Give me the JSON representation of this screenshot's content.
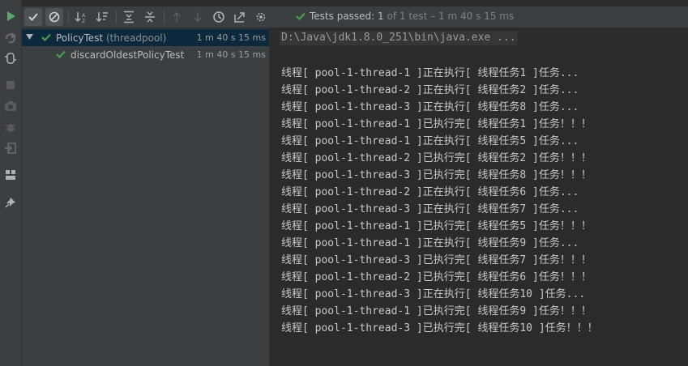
{
  "toolbar": {
    "buttons": [
      "show-passed",
      "show-ignored",
      "sort-alphabetically",
      "sort-by-duration",
      "expand-all",
      "collapse-all",
      "previous-failed",
      "next-failed",
      "test-history",
      "export-results",
      "settings"
    ]
  },
  "status": {
    "label": "Tests passed:",
    "count": "1",
    "of_text": "of 1 test",
    "duration_text": "– 1 m 40 s 15 ms"
  },
  "tree": {
    "root": {
      "name": "PolicyTest",
      "qualifier": "(threadpool)",
      "duration": "1 m 40 s 15 ms"
    },
    "children": [
      {
        "name": "discardOldestPolicyTest",
        "duration": "1 m 40 s 15 ms"
      }
    ]
  },
  "console": {
    "command": "D:\\Java\\jdk1.8.0_251\\bin\\java.exe ...",
    "lines": [
      "线程[ pool-1-thread-1 ]正在执行[ 线程任务1 ]任务...",
      "线程[ pool-1-thread-2 ]正在执行[ 线程任务2 ]任务...",
      "线程[ pool-1-thread-3 ]正在执行[ 线程任务8 ]任务...",
      "线程[ pool-1-thread-1 ]已执行完[ 线程任务1 ]任务！！！",
      "线程[ pool-1-thread-1 ]正在执行[ 线程任务5 ]任务...",
      "线程[ pool-1-thread-2 ]已执行完[ 线程任务2 ]任务！！！",
      "线程[ pool-1-thread-3 ]已执行完[ 线程任务8 ]任务！！！",
      "线程[ pool-1-thread-2 ]正在执行[ 线程任务6 ]任务...",
      "线程[ pool-1-thread-3 ]正在执行[ 线程任务7 ]任务...",
      "线程[ pool-1-thread-1 ]已执行完[ 线程任务5 ]任务！！！",
      "线程[ pool-1-thread-1 ]正在执行[ 线程任务9 ]任务...",
      "线程[ pool-1-thread-3 ]已执行完[ 线程任务7 ]任务！！！",
      "线程[ pool-1-thread-2 ]已执行完[ 线程任务6 ]任务！！！",
      "线程[ pool-1-thread-3 ]正在执行[ 线程任务10 ]任务...",
      "线程[ pool-1-thread-1 ]已执行完[ 线程任务9 ]任务！！！",
      "线程[ pool-1-thread-3 ]已执行完[ 线程任务10 ]任务！！！"
    ]
  },
  "colors": {
    "pass": "#499c54",
    "run": "#59a869",
    "background": "#2b2b2b",
    "panel": "#3c3f41",
    "selection": "#0d293e"
  }
}
